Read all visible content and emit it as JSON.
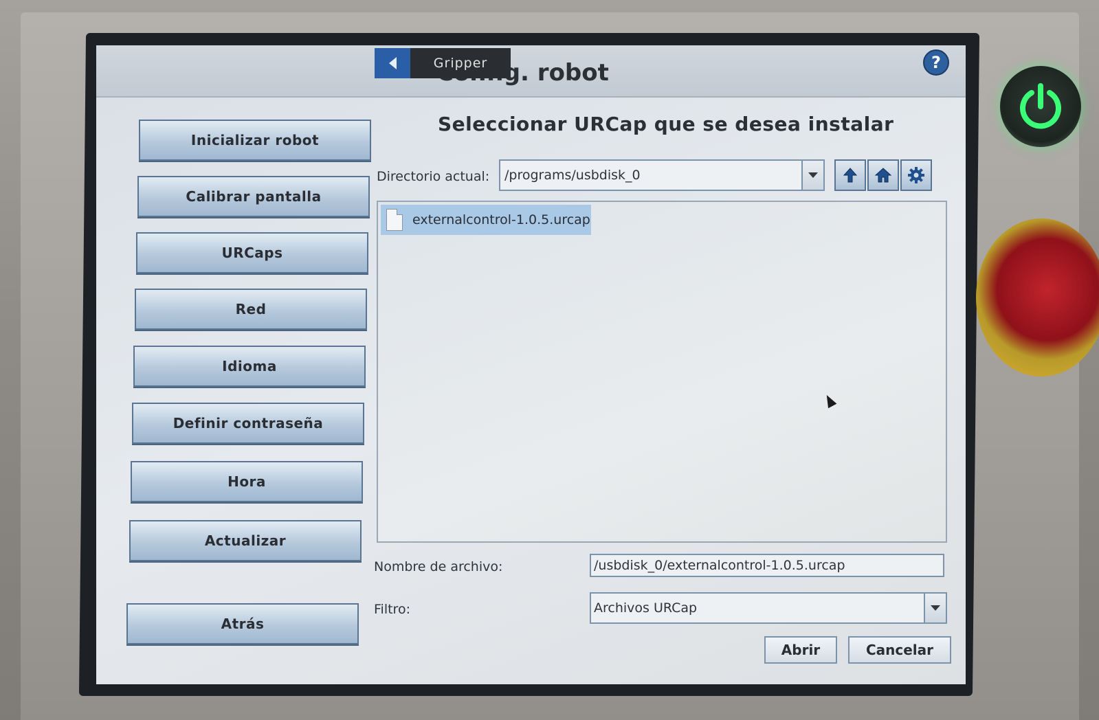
{
  "header": {
    "back_tab_label": "",
    "gripper_tab": "Gripper",
    "title": "Config. robot",
    "help_symbol": "?"
  },
  "menu": {
    "items": [
      {
        "label": "Inicializar robot"
      },
      {
        "label": "Calibrar pantalla"
      },
      {
        "label": "URCaps"
      },
      {
        "label": "Red"
      },
      {
        "label": "Idioma"
      },
      {
        "label": "Definir contraseña"
      },
      {
        "label": "Hora"
      },
      {
        "label": "Actualizar"
      }
    ],
    "back_label": "Atrás"
  },
  "dialog": {
    "title": "Seleccionar URCap que se desea instalar",
    "directory_label": "Directorio actual:",
    "directory_value": "/programs/usbdisk_0",
    "files": [
      {
        "name": "externalcontrol-1.0.5.urcap",
        "selected": true
      }
    ],
    "filename_label": "Nombre de archivo:",
    "filename_value": "/usbdisk_0/externalcontrol-1.0.5.urcap",
    "filter_label": "Filtro:",
    "filter_value": "Archivos URCap",
    "open_label": "Abrir",
    "cancel_label": "Cancelar"
  },
  "icons": {
    "parent_dir": "up-arrow-icon",
    "home": "home-icon",
    "settings": "gear-icon",
    "file": "file-icon"
  },
  "colors": {
    "accent": "#2a5fa8",
    "selection": "#a9c9e6",
    "power_glow": "#3cff78",
    "estop_red": "#c1242c"
  }
}
